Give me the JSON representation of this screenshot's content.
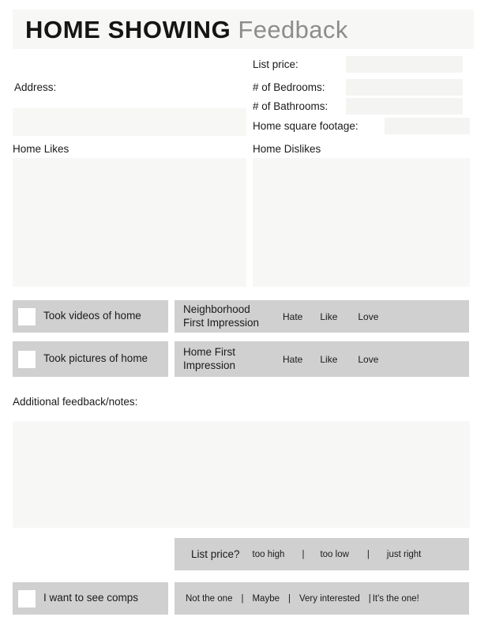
{
  "header": {
    "title_bold": "HOME SHOWING",
    "title_light": "Feedback",
    "band_color": "#f7f7f5"
  },
  "colors": {
    "field_fill": "#f7f7f5",
    "row_fill": "#d0d0d0",
    "checkbox_fill": "#ffffff",
    "text": "#1a1a1a",
    "title_light_text": "#8d8d8d"
  },
  "address": {
    "label": "Address:",
    "value": "",
    "placeholder": ""
  },
  "details": [
    {
      "label": "List price:",
      "value": "",
      "placeholder": ""
    },
    {
      "label": "# of Bedrooms:",
      "value": "",
      "placeholder": ""
    },
    {
      "label": "# of Bathrooms:",
      "value": "",
      "placeholder": ""
    },
    {
      "label": "Home square footage:",
      "value": "",
      "placeholder": ""
    }
  ],
  "likes": {
    "label": "Home Likes",
    "value": "",
    "placeholder": ""
  },
  "dislikes": {
    "label": "Home Dislikes",
    "value": "",
    "placeholder": ""
  },
  "checkboxes": [
    {
      "label": "Took videos of home",
      "checked": false
    },
    {
      "label": "Took pictures of home",
      "checked": false
    },
    {
      "label": "I want to see comps",
      "checked": false
    }
  ],
  "impressions": [
    {
      "title": "Neighborhood First Impression",
      "options": [
        "Hate",
        "Like",
        "Love"
      ]
    },
    {
      "title": "Home First Impression",
      "options": [
        "Hate",
        "Like",
        "Love"
      ]
    }
  ],
  "additional": {
    "label": "Additional feedback/notes:",
    "value": "",
    "placeholder": ""
  },
  "list_price_question": {
    "label": "List price?",
    "options": [
      "too high",
      "too low",
      "just right"
    ],
    "separator": "|"
  },
  "interest_level": {
    "options": [
      "Not the one",
      "Maybe",
      "Very interested",
      "It's the one!"
    ],
    "separator": "|"
  }
}
